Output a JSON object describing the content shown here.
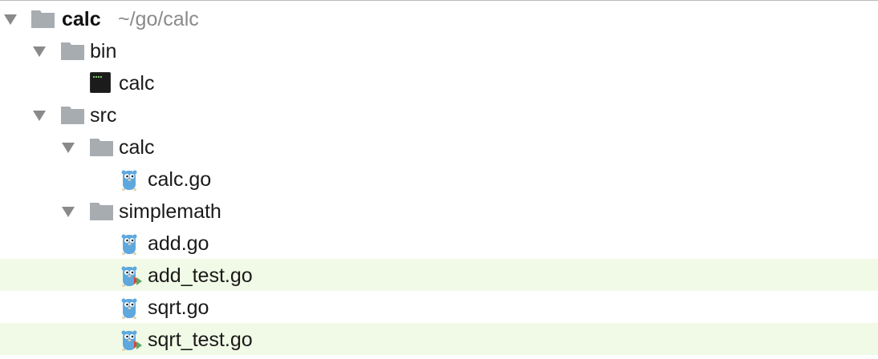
{
  "tree": {
    "root": {
      "name": "calc",
      "path": "~/go/calc",
      "icon": "folder-icon"
    },
    "bin": {
      "name": "bin",
      "icon": "folder-icon"
    },
    "bin_calc": {
      "name": "calc",
      "icon": "executable-icon"
    },
    "src": {
      "name": "src",
      "icon": "folder-icon"
    },
    "src_calc": {
      "name": "calc",
      "icon": "folder-icon"
    },
    "calc_go": {
      "name": "calc.go",
      "icon": "go-file-icon"
    },
    "simplemath": {
      "name": "simplemath",
      "icon": "folder-icon"
    },
    "add_go": {
      "name": "add.go",
      "icon": "go-file-icon"
    },
    "add_test_go": {
      "name": "add_test.go",
      "icon": "go-test-file-icon"
    },
    "sqrt_go": {
      "name": "sqrt.go",
      "icon": "go-file-icon"
    },
    "sqrt_test_go": {
      "name": "sqrt_test.go",
      "icon": "go-test-file-icon"
    }
  },
  "colors": {
    "folder": "#a7acb1",
    "arrow": "#8a8a8a",
    "gopher": "#5fa8de",
    "test_row_bg": "#f1fae6",
    "test_marker_red": "#d9453b",
    "test_marker_green": "#59a869"
  }
}
